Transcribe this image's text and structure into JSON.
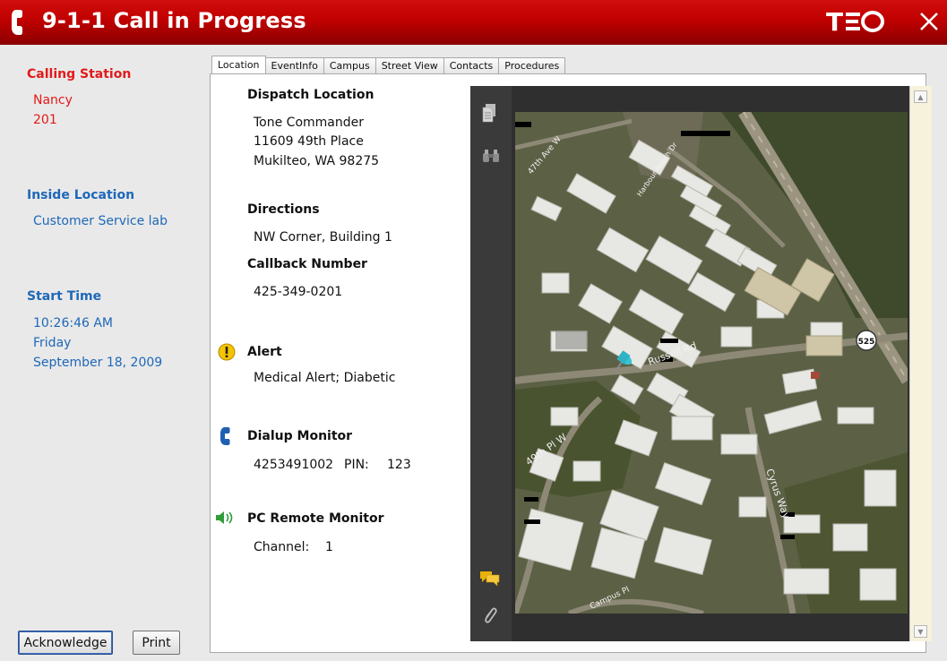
{
  "window": {
    "title": "9-1-1 Call in Progress",
    "brand": "TEO"
  },
  "left": {
    "calling_station": {
      "heading": "Calling Station",
      "name": "Nancy",
      "ext": "201"
    },
    "inside_location": {
      "heading": "Inside Location",
      "value": "Customer Service lab"
    },
    "start_time": {
      "heading": "Start Time",
      "time": "10:26:46 AM",
      "day": "Friday",
      "date": "September 18, 2009"
    },
    "buttons": {
      "acknowledge": "Acknowledge",
      "print": "Print"
    }
  },
  "tabs": [
    "Location",
    "EventInfo",
    "Campus",
    "Street View",
    "Contacts",
    "Procedures"
  ],
  "location": {
    "dispatch_label": "Dispatch Location",
    "dispatch_lines": [
      "Tone Commander",
      "11609 49th Place",
      "Mukilteo, WA 98275"
    ],
    "directions_label": "Directions",
    "directions": "NW Corner, Building 1",
    "callback_label": "Callback Number",
    "callback": "425-349-0201",
    "alert_label": "Alert",
    "alert": "Medical Alert; Diabetic",
    "dialup_label": "Dialup Monitor",
    "dialup": "4253491002",
    "pin_label": "PIN:",
    "pin": "123",
    "pc_label": "PC Remote Monitor",
    "channel_label": "Channel:",
    "channel": "1"
  },
  "map": {
    "street_labels": [
      "Russell Rd",
      "49th Pl W",
      "Cyrus Way",
      "Campus Pl",
      "47th Ave W",
      "Harbour Reach Dr"
    ],
    "route_shield": "525"
  },
  "icons": {
    "title_phone": "phone-handset-icon",
    "close": "close-x-icon",
    "alert": "exclamation-circle-icon",
    "dialup": "phone-icon",
    "speaker": "speaker-icon",
    "viewer_pages": "pages-icon",
    "viewer_binoculars": "binoculars-icon",
    "viewer_comments": "comments-icon",
    "viewer_attach": "paperclip-icon"
  },
  "colors": {
    "title_red": "#c00000",
    "heading_red": "#e21a1a",
    "heading_blue": "#1e68b8",
    "alert_yellow": "#f5c400",
    "phone_blue": "#1f5fb0",
    "speaker_green": "#2f9e3a"
  }
}
